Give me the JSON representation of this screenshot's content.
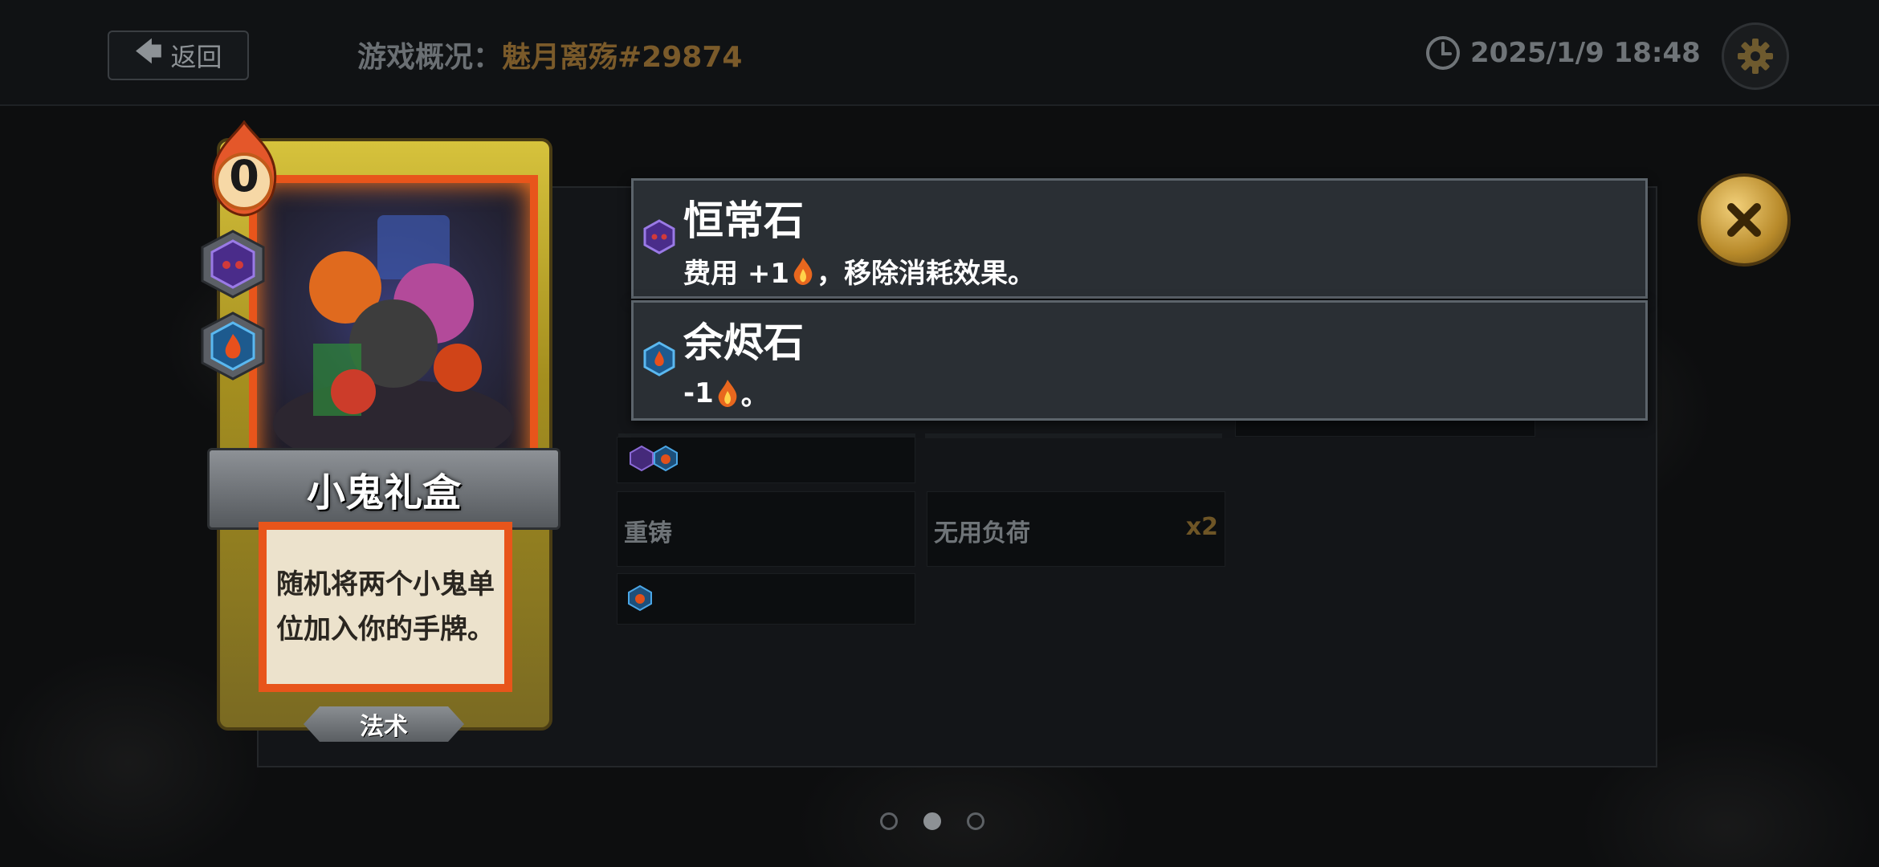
{
  "header": {
    "back_label": "返回",
    "overview_label": "游戏概况：",
    "player_name": "魅月离殇#29874",
    "datetime": "2025/1/9 18:48"
  },
  "card": {
    "cost": "0",
    "name": "小鬼礼盒",
    "description": "随机将两个小鬼单位加入你的手牌。",
    "type": "法术"
  },
  "tooltips": [
    {
      "title": "恒常石",
      "desc_before": "费用 +1",
      "desc_after": "，移除消耗效果。",
      "gem": "purple-gem-icon"
    },
    {
      "title": "余烬石",
      "desc_before": "-1",
      "desc_after": "。",
      "gem": "blue-gem-icon"
    }
  ],
  "panel": {
    "cells": [
      {
        "label": "重铸"
      },
      {
        "label": "无用负荷",
        "count": "x2"
      }
    ]
  },
  "pagination": {
    "total": 3,
    "current": 2
  },
  "colors": {
    "accent_gold": "#b88a2a",
    "card_border": "#e8551b",
    "player_name": "#7a5a2a"
  }
}
